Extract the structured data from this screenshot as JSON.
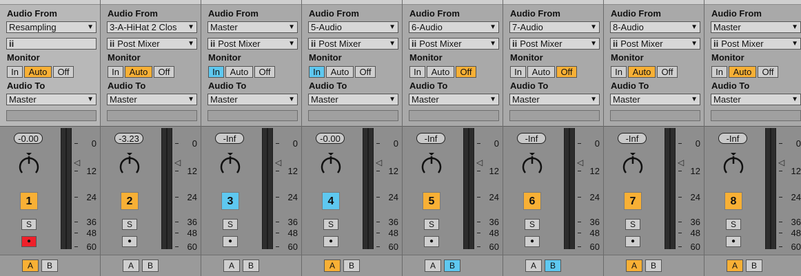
{
  "labels": {
    "audio_from": "Audio From",
    "monitor": "Monitor",
    "audio_to": "Audio To"
  },
  "monitor_buttons": [
    "In",
    "Auto",
    "Off"
  ],
  "meter_scale": [
    "0",
    "12",
    "24",
    "36",
    "48",
    "60"
  ],
  "colors": {
    "orange": "#f8b035",
    "blue": "#5ec8f0",
    "red": "#f0202a"
  },
  "tracks": [
    {
      "number": "1",
      "color": "orange",
      "audio_from": "Resampling",
      "channel": "",
      "monitor": "Auto",
      "audio_to": "Master",
      "volume": "-0.00",
      "solo": "S",
      "arm": "●",
      "armed": true,
      "crossfade": "A",
      "selected": true
    },
    {
      "number": "2",
      "color": "orange",
      "audio_from": "3-A-HiHat 2 Clos",
      "channel": "Post Mixer",
      "monitor": "Auto",
      "audio_to": "Master",
      "volume": "-3.23",
      "solo": "S",
      "arm": "●",
      "armed": false,
      "crossfade": "none",
      "selected": false
    },
    {
      "number": "3",
      "color": "blue",
      "audio_from": "Master",
      "channel": "Post Mixer",
      "monitor": "In",
      "audio_to": "Master",
      "volume": "-Inf",
      "solo": "S",
      "arm": "●",
      "armed": false,
      "crossfade": "none",
      "selected": false
    },
    {
      "number": "4",
      "color": "blue",
      "audio_from": "5-Audio",
      "channel": "Post Mixer",
      "monitor": "In",
      "audio_to": "Master",
      "volume": "-0.00",
      "solo": "S",
      "arm": "●",
      "armed": false,
      "crossfade": "A",
      "selected": false
    },
    {
      "number": "5",
      "color": "orange",
      "audio_from": "6-Audio",
      "channel": "Post Mixer",
      "monitor": "Off",
      "audio_to": "Master",
      "volume": "-Inf",
      "solo": "S",
      "arm": "●",
      "armed": false,
      "crossfade": "B",
      "selected": false
    },
    {
      "number": "6",
      "color": "orange",
      "audio_from": "7-Audio",
      "channel": "Post Mixer",
      "monitor": "Off",
      "audio_to": "Master",
      "volume": "-Inf",
      "solo": "S",
      "arm": "●",
      "armed": false,
      "crossfade": "B",
      "selected": false
    },
    {
      "number": "7",
      "color": "orange",
      "audio_from": "8-Audio",
      "channel": "Post Mixer",
      "monitor": "Auto",
      "audio_to": "Master",
      "volume": "-Inf",
      "solo": "S",
      "arm": "●",
      "armed": false,
      "crossfade": "A",
      "selected": false
    },
    {
      "number": "8",
      "color": "orange",
      "audio_from": "Master",
      "channel": "Post Mixer",
      "monitor": "Auto",
      "audio_to": "Master",
      "volume": "-Inf",
      "solo": "S",
      "arm": "●",
      "armed": false,
      "crossfade": "A",
      "selected": false
    }
  ]
}
